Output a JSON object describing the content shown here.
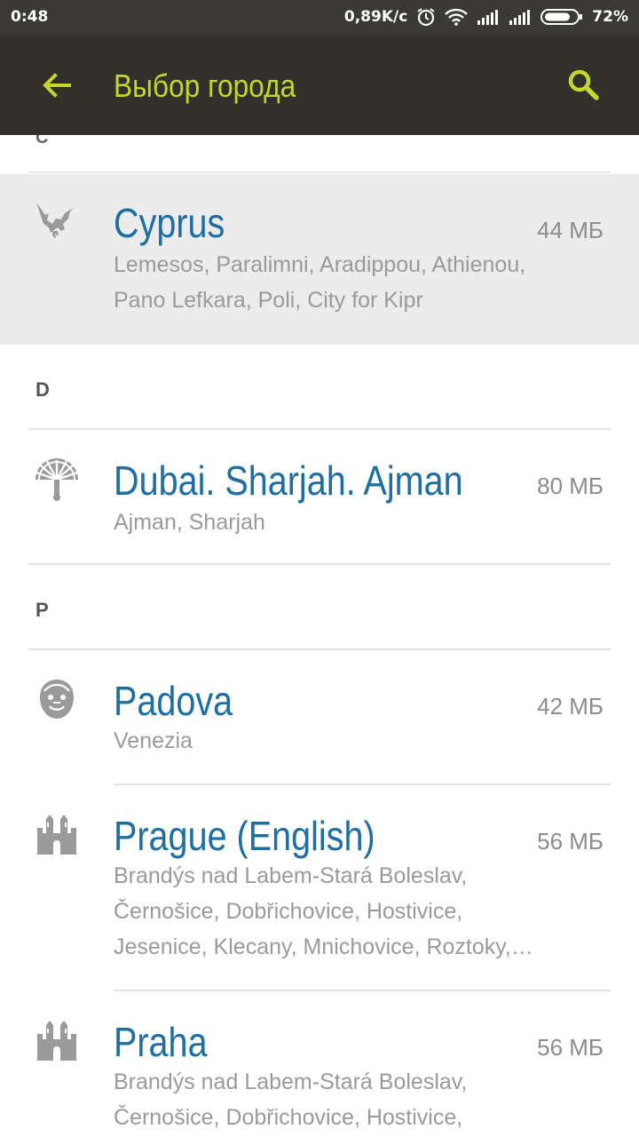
{
  "status_bar": {
    "time": "0:48",
    "network_speed": "0,89K/c",
    "battery": "72%",
    "icons": [
      "alarm-icon",
      "wifi-icon",
      "signal-icon",
      "signal-icon",
      "battery-icon"
    ]
  },
  "app_bar": {
    "title": "Выбор города",
    "back_icon": "back-arrow-icon",
    "search_icon": "search-icon",
    "accent_color": "#c4d52b",
    "background": "#31302a"
  },
  "list": {
    "partial_header": "C",
    "sections": [
      {
        "letter": "C",
        "cities": [
          {
            "name": "Cyprus",
            "size": "44 МБ",
            "icon": "eagle-icon",
            "selected": true,
            "sub_lines": [
              "Lemesos,  Paralimni,  Aradippou,  Athienou,",
              "Pano Lefkara,  Poli,  City for Kipr"
            ]
          }
        ]
      },
      {
        "letter": "D",
        "cities": [
          {
            "name": "Dubai. Sharjah. Ajman",
            "size": "80 МБ",
            "icon": "palm-island-icon",
            "selected": false,
            "sub_lines": [
              "Ajman,  Sharjah"
            ]
          }
        ]
      },
      {
        "letter": "P",
        "cities": [
          {
            "name": "Padova",
            "size": "42 МБ",
            "icon": "monkey-head-icon",
            "selected": false,
            "sub_lines": [
              "Venezia"
            ]
          },
          {
            "name": "Prague (English)",
            "size": "56 МБ",
            "icon": "castle-icon",
            "selected": false,
            "sub_lines": [
              "Brandýs nad Labem-Stará Boleslav,",
              "Černošice,  Dobřichovice,  Hostivice,",
              "Jesenice,  Klecany,  Mnichovice,  Roztoky,…"
            ]
          },
          {
            "name": "Praha",
            "size": "56 МБ",
            "icon": "castle-icon",
            "selected": false,
            "sub_lines": [
              "Brandýs nad Labem-Stará Boleslav,",
              "Černošice,  Dobřichovice,  Hostivice,"
            ]
          }
        ]
      }
    ]
  }
}
